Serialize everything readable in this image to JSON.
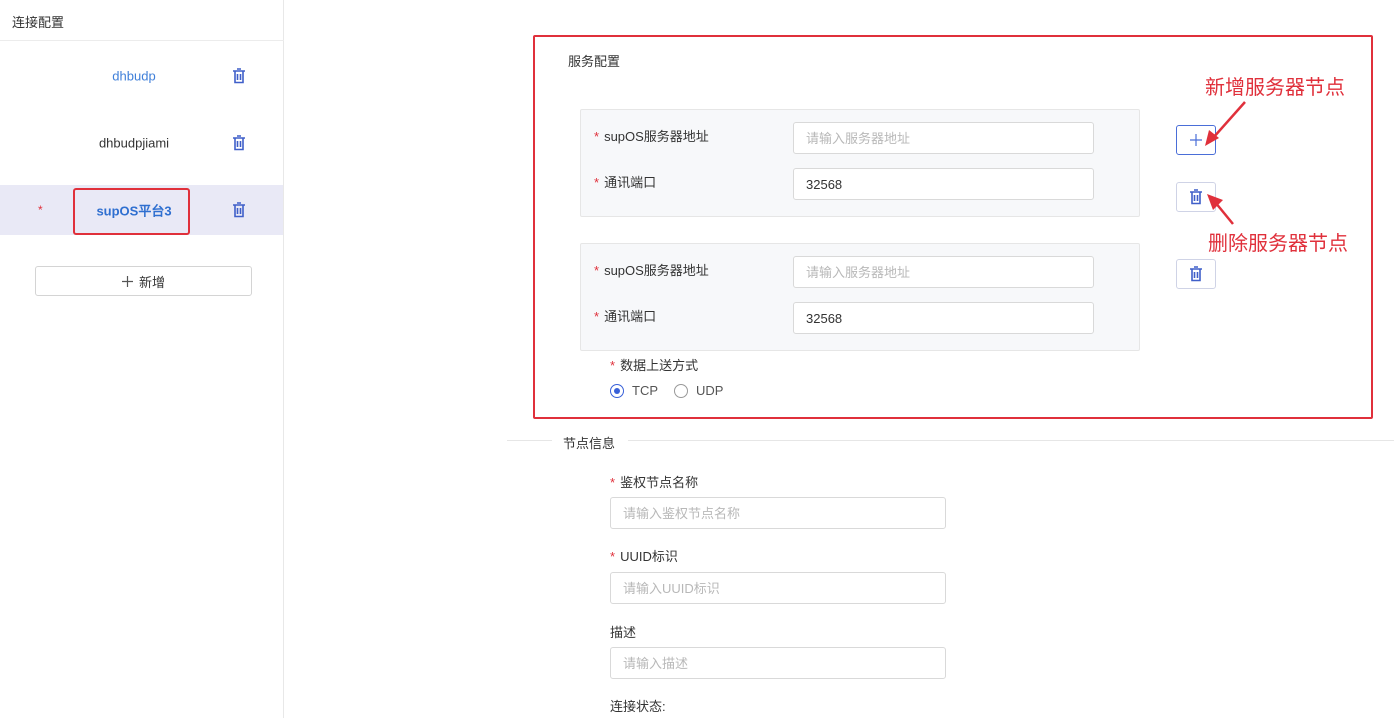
{
  "sidebar": {
    "title": "连接配置",
    "items": [
      {
        "label": "dhbudp",
        "color": "#3f7fd9"
      },
      {
        "label": "dhbudpjiami",
        "color": "#333333"
      },
      {
        "label": "supOS平台3",
        "color": "#2f6fd0",
        "required": "*"
      }
    ],
    "add_label": "新增",
    "add_icon": "plus-icon"
  },
  "service_config": {
    "title": "服务配置",
    "nodes": [
      {
        "address_label": "supOS服务器地址",
        "address_placeholder": "请输入服务器地址",
        "address_value": "",
        "port_label": "通讯端口",
        "port_value": "32568"
      },
      {
        "address_label": "supOS服务器地址",
        "address_placeholder": "请输入服务器地址",
        "address_value": "",
        "port_label": "通讯端口",
        "port_value": "32568"
      }
    ],
    "upload_mode_label": "数据上送方式",
    "upload_options": [
      {
        "label": "TCP",
        "checked": true
      },
      {
        "label": "UDP",
        "checked": false
      }
    ],
    "required_mark": "*"
  },
  "annotations": {
    "add_node": "新增服务器节点",
    "delete_node": "删除服务器节点"
  },
  "node_info": {
    "title": "节点信息",
    "auth_name_label": "鉴权节点名称",
    "auth_name_placeholder": "请输入鉴权节点名称",
    "uuid_label": "UUID标识",
    "uuid_placeholder": "请输入UUID标识",
    "desc_label": "描述",
    "desc_placeholder": "请输入描述",
    "status_label": "连接状态:"
  },
  "colors": {
    "accent": "#3860d8",
    "required": "#e0303b",
    "annotation": "#e0303b",
    "active_row": "#e9e9f6"
  }
}
